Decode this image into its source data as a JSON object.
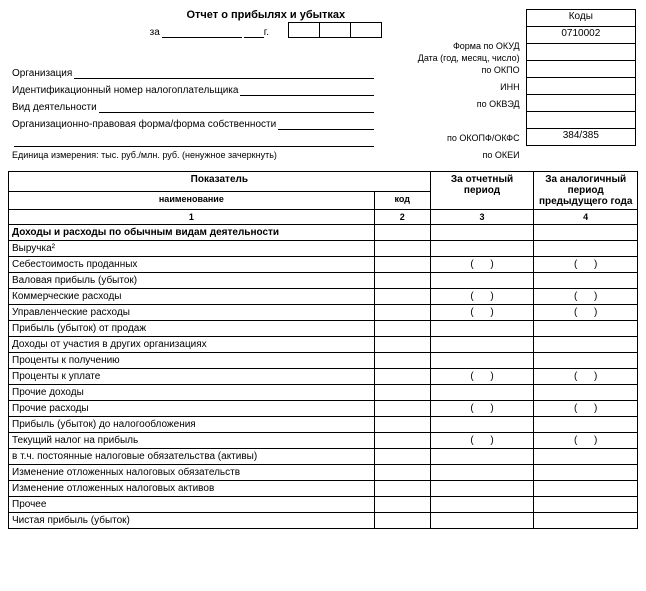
{
  "form": {
    "title": "Отчет о прибылях и убытках",
    "date_prefix": "за",
    "year_suffix": "г.",
    "right_header": "Коды",
    "okud_label": "Форма по ОКУД",
    "okud_code": "0710002",
    "date_label": "Дата (год, месяц, число)",
    "org_label": "Организация",
    "okpo_label": "по ОКПО",
    "inn_label": "Идентификационный номер налогоплательщика",
    "inn_code": "ИНН",
    "activity_label": "Вид деятельности",
    "okved_label": "по ОКВЭД",
    "legal_label": "Организационно-правовая форма/форма собственности",
    "okopf_label": "по ОКОПФ/ОКФС",
    "unit_label": "Единица измерения: тыс. руб./млн. руб. (ненужное зачеркнуть)",
    "okei_label": "по ОКЕИ",
    "okei_code": "384/385"
  },
  "table": {
    "col_name": "Показатель",
    "col_name_sub": "наименование",
    "col_code": "код",
    "col_period1": "За отчетный период",
    "col_period2": "За аналогичный период предыдущего года",
    "hnum1": "1",
    "hnum2": "2",
    "hnum3": "3",
    "hnum4": "4"
  },
  "rows": [
    {
      "name": "Доходы и расходы по обычным видам деятельности",
      "bold": true
    },
    {
      "name": "Выручка²",
      "v3": "",
      "v4": ""
    },
    {
      "name": "Себестоимость проданных",
      "p": true
    },
    {
      "name": "Валовая прибыль (убыток)",
      "v3": "",
      "v4": ""
    },
    {
      "name": "Коммерческие расходы",
      "p": true
    },
    {
      "name": "Управленческие расходы",
      "p": true
    },
    {
      "name": "   Прибыль (убыток) от продаж",
      "v3": "",
      "v4": ""
    },
    {
      "name": "Доходы от участия в других организациях",
      "v3": "",
      "v4": ""
    },
    {
      "name": "Проценты к получению",
      "v3": "",
      "v4": ""
    },
    {
      "name": "Проценты к уплате",
      "p": true
    },
    {
      "name": "Прочие доходы",
      "v3": "",
      "v4": ""
    },
    {
      "name": "Прочие расходы",
      "p": true
    },
    {
      "name": "   Прибыль (убыток) до налогообложения",
      "v3": "",
      "v4": ""
    },
    {
      "name": "Текущий налог на прибыль",
      "p": true
    },
    {
      "name": "   в т.ч. постоянные налоговые обязательства (активы)",
      "v3": "",
      "v4": ""
    },
    {
      "name": "Изменение отложенных налоговых обязательств",
      "v3": "",
      "v4": ""
    },
    {
      "name": "Изменение отложенных налоговых активов",
      "v3": "",
      "v4": ""
    },
    {
      "name": "Прочее",
      "v3": "",
      "v4": ""
    },
    {
      "name": "   Чистая прибыль (убыток)",
      "v3": "",
      "v4": ""
    }
  ]
}
